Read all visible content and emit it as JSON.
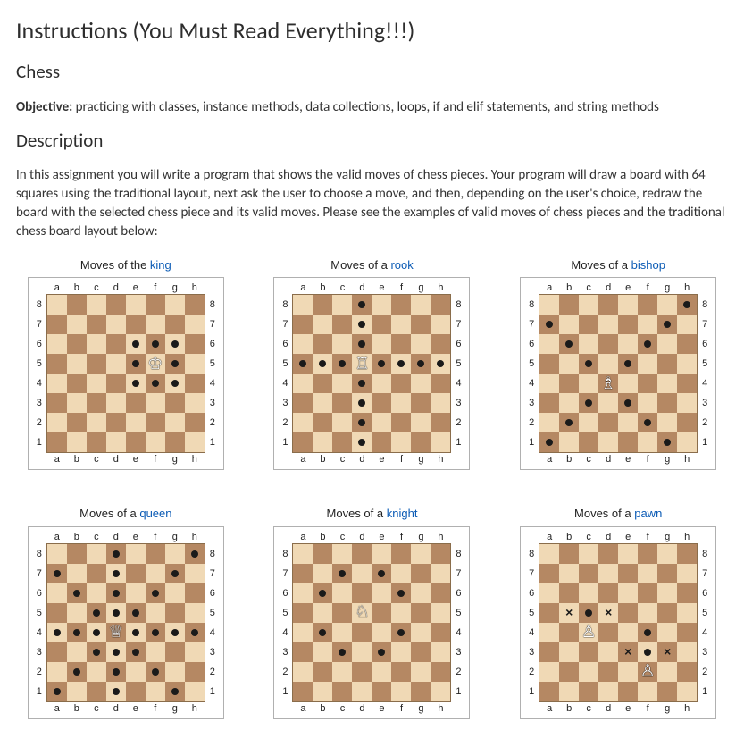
{
  "headings": {
    "main": "Instructions (You Must Read Everything!!!)",
    "game": "Chess",
    "desc": "Description"
  },
  "text": {
    "objective_label": "Objective:",
    "objective_body": " practicing with classes, instance methods, data collections, loops, if and elif statements, and string methods",
    "desc_body": "In this assignment you will write a program that shows the valid moves of chess pieces. Your program will draw a board with 64 squares using the traditional layout, next ask the user to choose a move, and then, depending on the user's choice, redraw the board with the selected chess piece and its valid moves. Please see the examples of valid moves of chess pieces and the traditional chess board layout below:"
  },
  "board": {
    "files": [
      "a",
      "b",
      "c",
      "d",
      "e",
      "f",
      "g",
      "h"
    ],
    "ranks": [
      "8",
      "7",
      "6",
      "5",
      "4",
      "3",
      "2",
      "1"
    ],
    "colors": {
      "light": "#f0d9b5",
      "dark": "#b58863"
    }
  },
  "pieces_unicode": {
    "king": "♔",
    "queen": "♕",
    "rook": "♖",
    "bishop": "♗",
    "knight": "♘",
    "pawn": "♙"
  },
  "diagrams": [
    {
      "name": "king",
      "title_prefix": "Moves of the ",
      "link_text": "king",
      "piece_square": "f5",
      "move_squares": [
        "e6",
        "f6",
        "g6",
        "e5",
        "g5",
        "e4",
        "f4",
        "g4"
      ],
      "capture_squares": []
    },
    {
      "name": "rook",
      "title_prefix": "Moves of a ",
      "link_text": "rook",
      "piece_square": "d5",
      "move_squares": [
        "d8",
        "d7",
        "d6",
        "a5",
        "b5",
        "c5",
        "e5",
        "f5",
        "g5",
        "h5",
        "d4",
        "d3",
        "d2",
        "d1"
      ],
      "capture_squares": []
    },
    {
      "name": "bishop",
      "title_prefix": "Moves of a ",
      "link_text": "bishop",
      "piece_square": "d4",
      "move_squares": [
        "h8",
        "a7",
        "g7",
        "b6",
        "f6",
        "c5",
        "e5",
        "c3",
        "e3",
        "b2",
        "f2",
        "a1",
        "g1"
      ],
      "capture_squares": []
    },
    {
      "name": "queen",
      "title_prefix": "Moves of a ",
      "link_text": "queen",
      "piece_square": "d4",
      "move_squares": [
        "d8",
        "h8",
        "a7",
        "d7",
        "g7",
        "b6",
        "d6",
        "f6",
        "c5",
        "d5",
        "e5",
        "a4",
        "b4",
        "c4",
        "e4",
        "f4",
        "g4",
        "h4",
        "c3",
        "d3",
        "e3",
        "b2",
        "d2",
        "f2",
        "a1",
        "d1",
        "g1"
      ],
      "capture_squares": []
    },
    {
      "name": "knight",
      "title_prefix": "Moves of a ",
      "link_text": "knight",
      "piece_square": "d5",
      "move_squares": [
        "c7",
        "e7",
        "b6",
        "f6",
        "b4",
        "f4",
        "c3",
        "e3"
      ],
      "capture_squares": []
    },
    {
      "name": "pawn",
      "title_prefix": "Moves of a ",
      "link_text": "pawn",
      "piece_square": "c4",
      "piece_square_extra": "f2",
      "move_squares": [
        "c5",
        "f4",
        "f3"
      ],
      "capture_squares": [
        "b5",
        "d5",
        "e3",
        "g3"
      ]
    }
  ]
}
